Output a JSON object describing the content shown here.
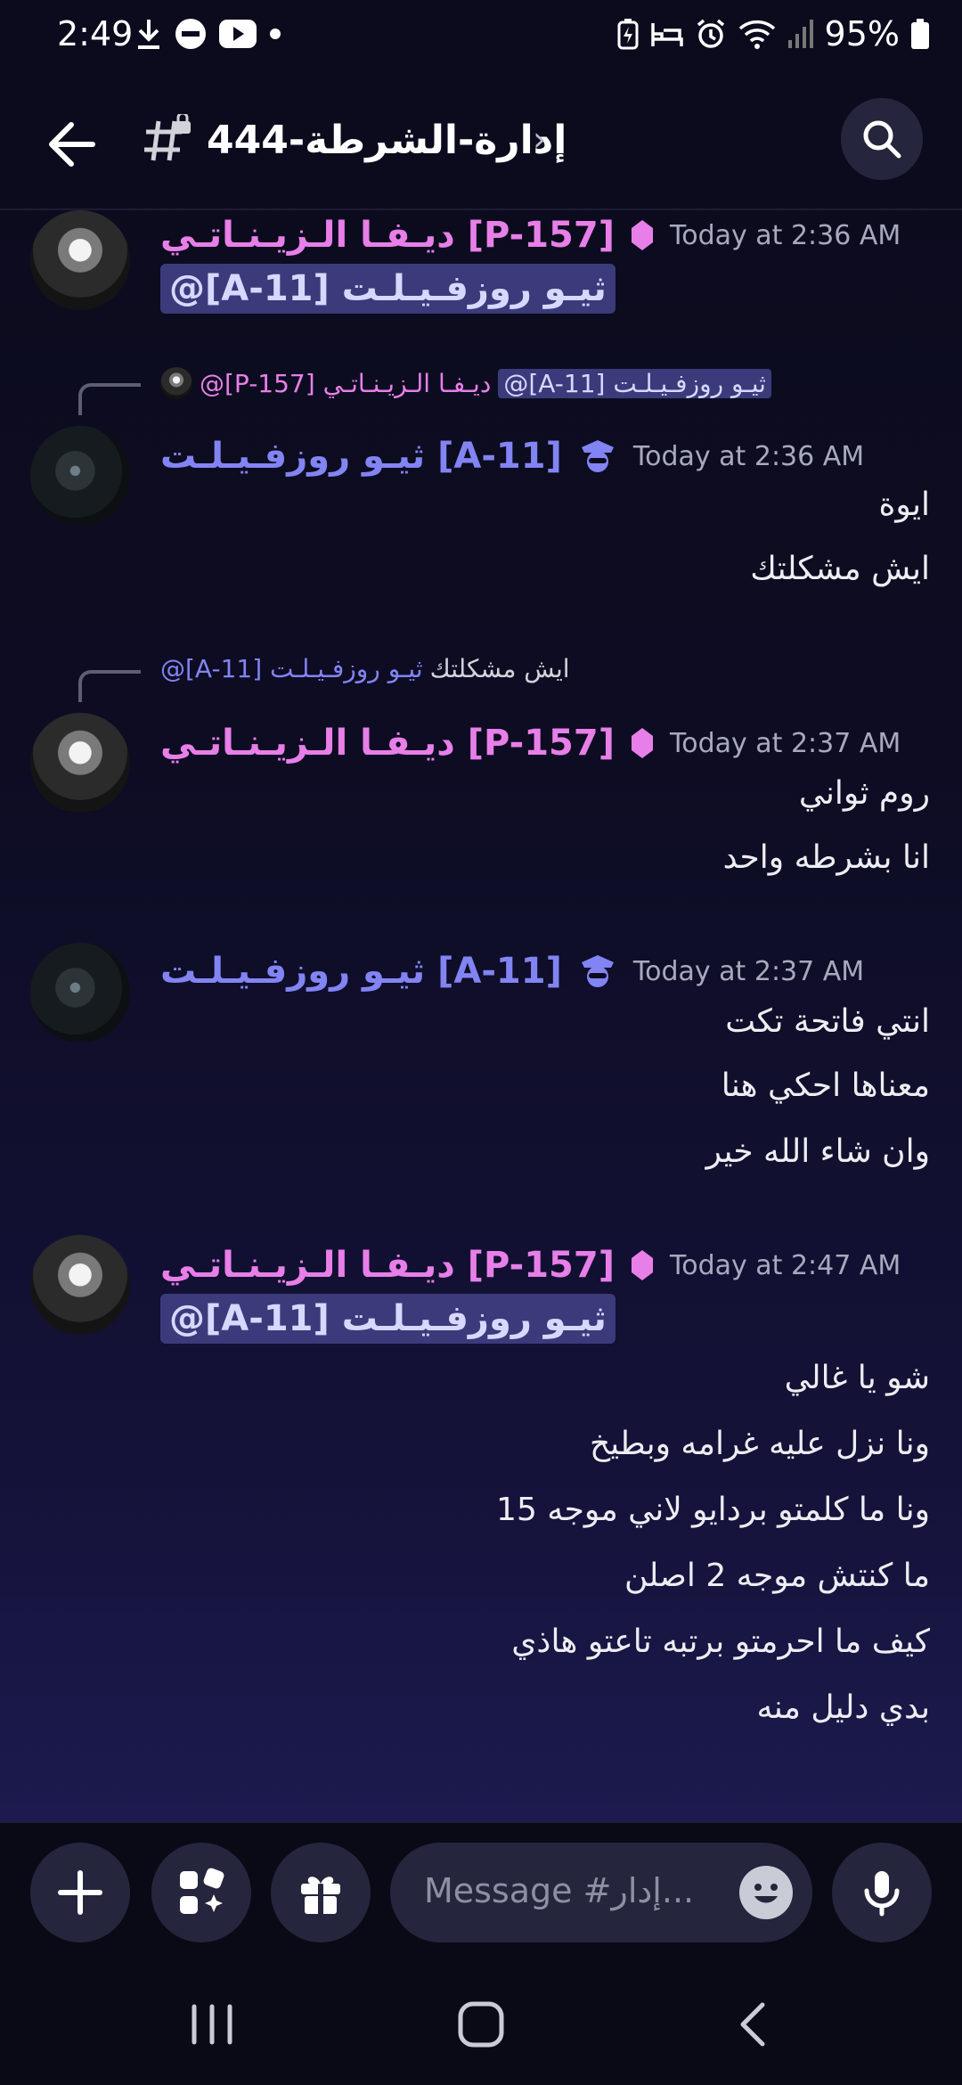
{
  "status_bar": {
    "time": "2:49",
    "battery": "95%"
  },
  "header": {
    "channel_name": "إدارة-الشرطة-444",
    "chevron": "›"
  },
  "messages": [
    {
      "author": "ديـفـا الـزيـنـاتـي [P-157]",
      "author_color": "#e87fe8",
      "timestamp": "Today at 2:36 AM",
      "mention": "@[A-11] ثيـو روزفـيـلـت",
      "lines": []
    },
    {
      "reply": {
        "author": "@[P-157] ديـفـا الـزيـنـاتـي",
        "mention": "@[A-11] ثيـو روزفـيـلـت"
      },
      "author": "ثيـو روزفـيـلـت [A-11]",
      "author_color": "#8284f4",
      "timestamp": "Today at 2:36 AM",
      "lines": [
        "ايوة",
        "ايش مشكلتك"
      ]
    },
    {
      "reply": {
        "author": "@[A-11] ثيـو روزفـيـلـت",
        "text": "ايش مشكلتك"
      },
      "author": "ديـفـا الـزيـنـاتـي [P-157]",
      "author_color": "#e87fe8",
      "timestamp": "Today at 2:37 AM",
      "lines": [
        "روم ثواني",
        "انا بشرطه واحد"
      ]
    },
    {
      "author": "ثيـو روزفـيـلـت [A-11]",
      "author_color": "#8284f4",
      "timestamp": "Today at 2:37 AM",
      "lines": [
        "انتي فاتحة تكت",
        "معناها احكي هنا",
        "وان شاء الله خير"
      ]
    },
    {
      "author": "ديـفـا الـزيـنـاتـي [P-157]",
      "author_color": "#e87fe8",
      "timestamp": "Today at 2:47 AM",
      "mention": "@[A-11] ثيـو روزفـيـلـت",
      "lines": [
        "شو يا غالي",
        "ونا نزل عليه غرامه وبطيخ",
        "ونا ما كلمتو بردايو لاني موجه 15",
        "ما كنتش موجه 2 اصلن",
        "كيف ما احرمتو برتبه تاعتو هاذي",
        "بدي دليل منه"
      ]
    }
  ],
  "composer": {
    "placeholder": "Message #إدار..."
  },
  "icons": [
    "back-arrow-icon",
    "hashtag-lock-icon",
    "search-icon",
    "plus-icon",
    "apps-icon",
    "gift-icon",
    "emoji-icon",
    "microphone-icon",
    "recents-icon",
    "home-icon",
    "back-nav-icon"
  ]
}
